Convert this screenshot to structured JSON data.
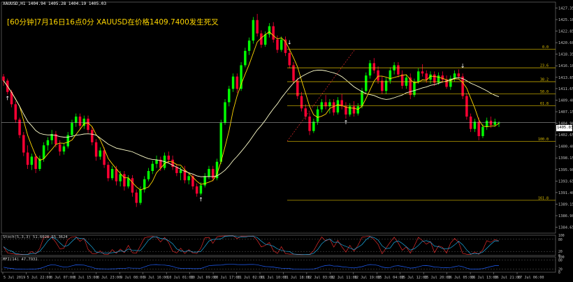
{
  "window": {
    "symbol_header": "XAUUSD,H1  1404.94 1405.28 1404.19 1405.03",
    "annotation": "[60分钟]7月16日16点0分 XAUUSD在价格1409.7400发生死叉",
    "current_price": "1405.03"
  },
  "indicators": {
    "stoch_label": "Stoch(5,3,3) 51.6028 55.3624",
    "mfi_label": "MFI(14) 47.7931"
  },
  "colors": {
    "background": "#000000",
    "bull_candle": "#00ff00",
    "bear_candle": "#ff0033",
    "ma_fast": "#ffd700",
    "ma_slow": "#ffffcc",
    "fib": "#e0c000",
    "stoch_main": "#ff3030",
    "stoch_signal": "#20c0ff",
    "mfi": "#2060ff",
    "axis_text": "#c0c0c0"
  },
  "chart_data": {
    "type": "candlestick",
    "title": "",
    "price_axis_ticks": [
      "1427.35",
      "1425.10",
      "1422.85",
      "1420.60",
      "1418.35",
      "1416.10",
      "1413.85",
      "1411.65",
      "1409.40",
      "1407.15",
      "1404.90",
      "1402.65",
      "1400.40",
      "1398.15",
      "1395.90",
      "1393.65",
      "1391.40",
      "1389.15",
      "1386.90",
      "1384.65"
    ],
    "ylim": [
      1383.5,
      1428.5
    ],
    "time_axis_labels": [
      "5 Jul 2019",
      "5 Jul 22:00",
      "8 Jul 07:00",
      "8 Jul 15:00",
      "8 Jul 23:00",
      "9 Jul 08:00",
      "9 Jul 16:00",
      "10 Jul 01:00",
      "10 Jul 09:00",
      "10 Jul 17:00",
      "11 Jul 02:00",
      "11 Jul 10:00",
      "11 Jul 18:00",
      "12 Jul 03:00",
      "12 Jul 11:00",
      "12 Jul 19:00",
      "15 Jul 04:00",
      "15 Jul 12:00",
      "15 Jul 20:00",
      "16 Jul 05:00",
      "16 Jul 13:00",
      "16 Jul 21:00",
      "17 Jul 06:00"
    ],
    "fib_levels": [
      {
        "label": "0.0",
        "price": 1419.3
      },
      {
        "label": "23.6",
        "price": 1415.7
      },
      {
        "label": "38.2",
        "price": 1413.0
      },
      {
        "label": "50.0",
        "price": 1410.6
      },
      {
        "label": "61.8",
        "price": 1408.3
      },
      {
        "label": "100.0",
        "price": 1401.4
      },
      {
        "label": "161.8",
        "price": 1389.9
      }
    ],
    "stoch_ticks": [
      "100",
      "80",
      "20",
      "0"
    ],
    "mfi_ticks": [
      "100",
      "80",
      "20",
      "0"
    ],
    "candles_ohlc": [
      [
        1414.0,
        1414.5,
        1412.2,
        1413.2
      ],
      [
        1413.2,
        1413.6,
        1410.5,
        1411.0
      ],
      [
        1411.0,
        1411.4,
        1408.0,
        1408.6
      ],
      [
        1408.6,
        1409.2,
        1405.0,
        1405.6
      ],
      [
        1405.6,
        1406.0,
        1402.0,
        1402.6
      ],
      [
        1402.6,
        1403.2,
        1398.5,
        1399.2
      ],
      [
        1399.2,
        1400.6,
        1396.0,
        1396.8
      ],
      [
        1396.8,
        1399.0,
        1395.8,
        1398.4
      ],
      [
        1398.4,
        1398.9,
        1395.2,
        1396.0
      ],
      [
        1396.0,
        1398.6,
        1395.6,
        1398.0
      ],
      [
        1398.0,
        1401.2,
        1397.4,
        1400.6
      ],
      [
        1400.6,
        1402.2,
        1399.6,
        1401.6
      ],
      [
        1401.6,
        1403.6,
        1400.8,
        1402.8
      ],
      [
        1402.8,
        1403.4,
        1400.2,
        1400.8
      ],
      [
        1400.8,
        1401.6,
        1398.6,
        1399.4
      ],
      [
        1399.4,
        1401.0,
        1398.8,
        1400.4
      ],
      [
        1400.4,
        1403.2,
        1400.0,
        1402.6
      ],
      [
        1402.6,
        1405.6,
        1402.2,
        1405.0
      ],
      [
        1405.0,
        1406.8,
        1404.2,
        1406.2
      ],
      [
        1406.2,
        1406.8,
        1403.6,
        1404.4
      ],
      [
        1404.4,
        1406.4,
        1403.8,
        1405.8
      ],
      [
        1405.8,
        1406.4,
        1403.0,
        1403.6
      ],
      [
        1403.6,
        1404.2,
        1400.6,
        1401.2
      ],
      [
        1401.2,
        1401.8,
        1397.6,
        1398.4
      ],
      [
        1398.4,
        1400.2,
        1397.8,
        1399.6
      ],
      [
        1399.6,
        1400.2,
        1396.2,
        1396.8
      ],
      [
        1396.8,
        1397.4,
        1393.6,
        1394.2
      ],
      [
        1394.2,
        1396.6,
        1393.8,
        1396.0
      ],
      [
        1396.0,
        1396.6,
        1392.8,
        1393.6
      ],
      [
        1393.6,
        1395.6,
        1392.6,
        1395.0
      ],
      [
        1395.0,
        1395.6,
        1391.8,
        1392.6
      ],
      [
        1392.6,
        1394.8,
        1392.2,
        1394.2
      ],
      [
        1394.2,
        1394.8,
        1390.6,
        1391.4
      ],
      [
        1391.4,
        1392.0,
        1388.6,
        1389.4
      ],
      [
        1389.4,
        1392.6,
        1389.0,
        1392.0
      ],
      [
        1392.0,
        1394.6,
        1391.4,
        1394.0
      ],
      [
        1394.0,
        1396.2,
        1393.6,
        1395.6
      ],
      [
        1395.6,
        1397.6,
        1395.0,
        1397.0
      ],
      [
        1397.0,
        1398.6,
        1396.2,
        1397.8
      ],
      [
        1397.8,
        1398.4,
        1395.6,
        1396.2
      ],
      [
        1396.2,
        1399.2,
        1395.8,
        1398.6
      ],
      [
        1398.6,
        1399.4,
        1397.2,
        1397.8
      ],
      [
        1397.8,
        1398.6,
        1395.8,
        1396.4
      ],
      [
        1396.4,
        1397.0,
        1394.6,
        1395.2
      ],
      [
        1395.2,
        1396.4,
        1393.8,
        1395.8
      ],
      [
        1395.8,
        1396.6,
        1393.2,
        1393.8
      ],
      [
        1393.8,
        1395.2,
        1393.0,
        1394.6
      ],
      [
        1394.6,
        1395.0,
        1392.0,
        1392.6
      ],
      [
        1392.6,
        1393.2,
        1390.6,
        1391.2
      ],
      [
        1391.2,
        1393.4,
        1390.8,
        1392.8
      ],
      [
        1392.8,
        1395.2,
        1392.4,
        1394.6
      ],
      [
        1394.6,
        1396.6,
        1394.0,
        1396.0
      ],
      [
        1396.0,
        1396.6,
        1393.6,
        1394.2
      ],
      [
        1394.2,
        1398.0,
        1393.8,
        1397.4
      ],
      [
        1397.4,
        1405.6,
        1397.0,
        1405.0
      ],
      [
        1405.0,
        1409.6,
        1404.6,
        1409.0
      ],
      [
        1409.0,
        1412.2,
        1408.2,
        1411.6
      ],
      [
        1411.6,
        1414.6,
        1411.0,
        1414.0
      ],
      [
        1414.0,
        1414.6,
        1410.8,
        1411.6
      ],
      [
        1411.6,
        1416.8,
        1411.2,
        1416.2
      ],
      [
        1416.2,
        1419.6,
        1415.8,
        1419.0
      ],
      [
        1419.0,
        1421.6,
        1418.2,
        1421.0
      ],
      [
        1421.0,
        1425.6,
        1420.4,
        1425.0
      ],
      [
        1425.0,
        1426.2,
        1421.8,
        1422.4
      ],
      [
        1422.4,
        1423.0,
        1419.6,
        1420.2
      ],
      [
        1420.2,
        1422.8,
        1419.8,
        1422.2
      ],
      [
        1422.2,
        1424.4,
        1421.6,
        1423.8
      ],
      [
        1423.8,
        1424.6,
        1420.6,
        1421.2
      ],
      [
        1421.2,
        1422.0,
        1418.6,
        1419.2
      ],
      [
        1419.2,
        1421.8,
        1418.8,
        1421.2
      ],
      [
        1421.2,
        1421.8,
        1418.0,
        1418.6
      ],
      [
        1418.6,
        1419.2,
        1415.6,
        1416.2
      ],
      [
        1416.2,
        1416.8,
        1412.6,
        1413.2
      ],
      [
        1413.2,
        1413.8,
        1409.6,
        1410.2
      ],
      [
        1410.2,
        1411.0,
        1407.2,
        1407.8
      ],
      [
        1407.8,
        1408.6,
        1405.6,
        1406.2
      ],
      [
        1406.2,
        1407.0,
        1402.6,
        1403.4
      ],
      [
        1403.4,
        1405.8,
        1403.0,
        1405.2
      ],
      [
        1405.2,
        1408.2,
        1404.6,
        1407.6
      ],
      [
        1407.6,
        1409.6,
        1407.0,
        1409.0
      ],
      [
        1409.0,
        1410.4,
        1407.6,
        1408.2
      ],
      [
        1408.2,
        1409.6,
        1406.8,
        1409.0
      ],
      [
        1409.0,
        1409.6,
        1406.4,
        1407.0
      ],
      [
        1407.0,
        1410.0,
        1406.6,
        1409.4
      ],
      [
        1409.4,
        1410.6,
        1407.6,
        1408.2
      ],
      [
        1408.2,
        1409.0,
        1405.8,
        1406.6
      ],
      [
        1406.6,
        1408.8,
        1406.2,
        1408.2
      ],
      [
        1408.2,
        1409.2,
        1406.2,
        1406.8
      ],
      [
        1406.8,
        1408.8,
        1406.4,
        1408.2
      ],
      [
        1408.2,
        1411.8,
        1407.8,
        1411.2
      ],
      [
        1411.2,
        1414.8,
        1410.8,
        1414.2
      ],
      [
        1414.2,
        1417.2,
        1413.6,
        1416.6
      ],
      [
        1416.6,
        1417.6,
        1414.6,
        1415.2
      ],
      [
        1415.2,
        1416.0,
        1412.6,
        1413.2
      ],
      [
        1413.2,
        1414.0,
        1410.6,
        1411.2
      ],
      [
        1411.2,
        1413.8,
        1410.6,
        1413.2
      ],
      [
        1413.2,
        1415.8,
        1412.6,
        1415.2
      ],
      [
        1415.2,
        1416.8,
        1414.4,
        1416.2
      ],
      [
        1416.2,
        1416.8,
        1413.8,
        1414.4
      ],
      [
        1414.4,
        1415.2,
        1411.6,
        1412.2
      ],
      [
        1412.2,
        1414.4,
        1411.6,
        1413.8
      ],
      [
        1413.8,
        1414.6,
        1409.6,
        1410.4
      ],
      [
        1410.4,
        1413.6,
        1410.0,
        1413.0
      ],
      [
        1413.0,
        1415.6,
        1412.6,
        1415.0
      ],
      [
        1415.0,
        1416.4,
        1414.0,
        1414.6
      ],
      [
        1414.6,
        1415.2,
        1412.8,
        1413.4
      ],
      [
        1413.4,
        1415.0,
        1412.6,
        1414.4
      ],
      [
        1414.4,
        1415.0,
        1412.2,
        1412.8
      ],
      [
        1412.8,
        1414.8,
        1412.4,
        1414.2
      ],
      [
        1414.2,
        1415.0,
        1412.8,
        1413.4
      ],
      [
        1413.4,
        1414.2,
        1411.6,
        1412.0
      ],
      [
        1412.0,
        1414.2,
        1411.4,
        1413.6
      ],
      [
        1413.6,
        1415.2,
        1413.0,
        1414.6
      ],
      [
        1414.6,
        1415.4,
        1413.6,
        1414.0
      ],
      [
        1414.0,
        1414.6,
        1409.6,
        1410.2
      ],
      [
        1410.2,
        1410.8,
        1405.6,
        1406.2
      ],
      [
        1406.2,
        1406.8,
        1403.2,
        1403.8
      ],
      [
        1403.8,
        1405.8,
        1403.2,
        1405.2
      ],
      [
        1405.2,
        1406.0,
        1401.6,
        1402.4
      ],
      [
        1402.4,
        1404.8,
        1402.0,
        1404.2
      ],
      [
        1404.2,
        1406.0,
        1403.6,
        1405.4
      ],
      [
        1405.4,
        1406.2,
        1404.0,
        1404.6
      ],
      [
        1404.6,
        1405.8,
        1404.2,
        1405.2
      ],
      [
        1404.94,
        1405.28,
        1404.19,
        1405.03
      ]
    ]
  }
}
